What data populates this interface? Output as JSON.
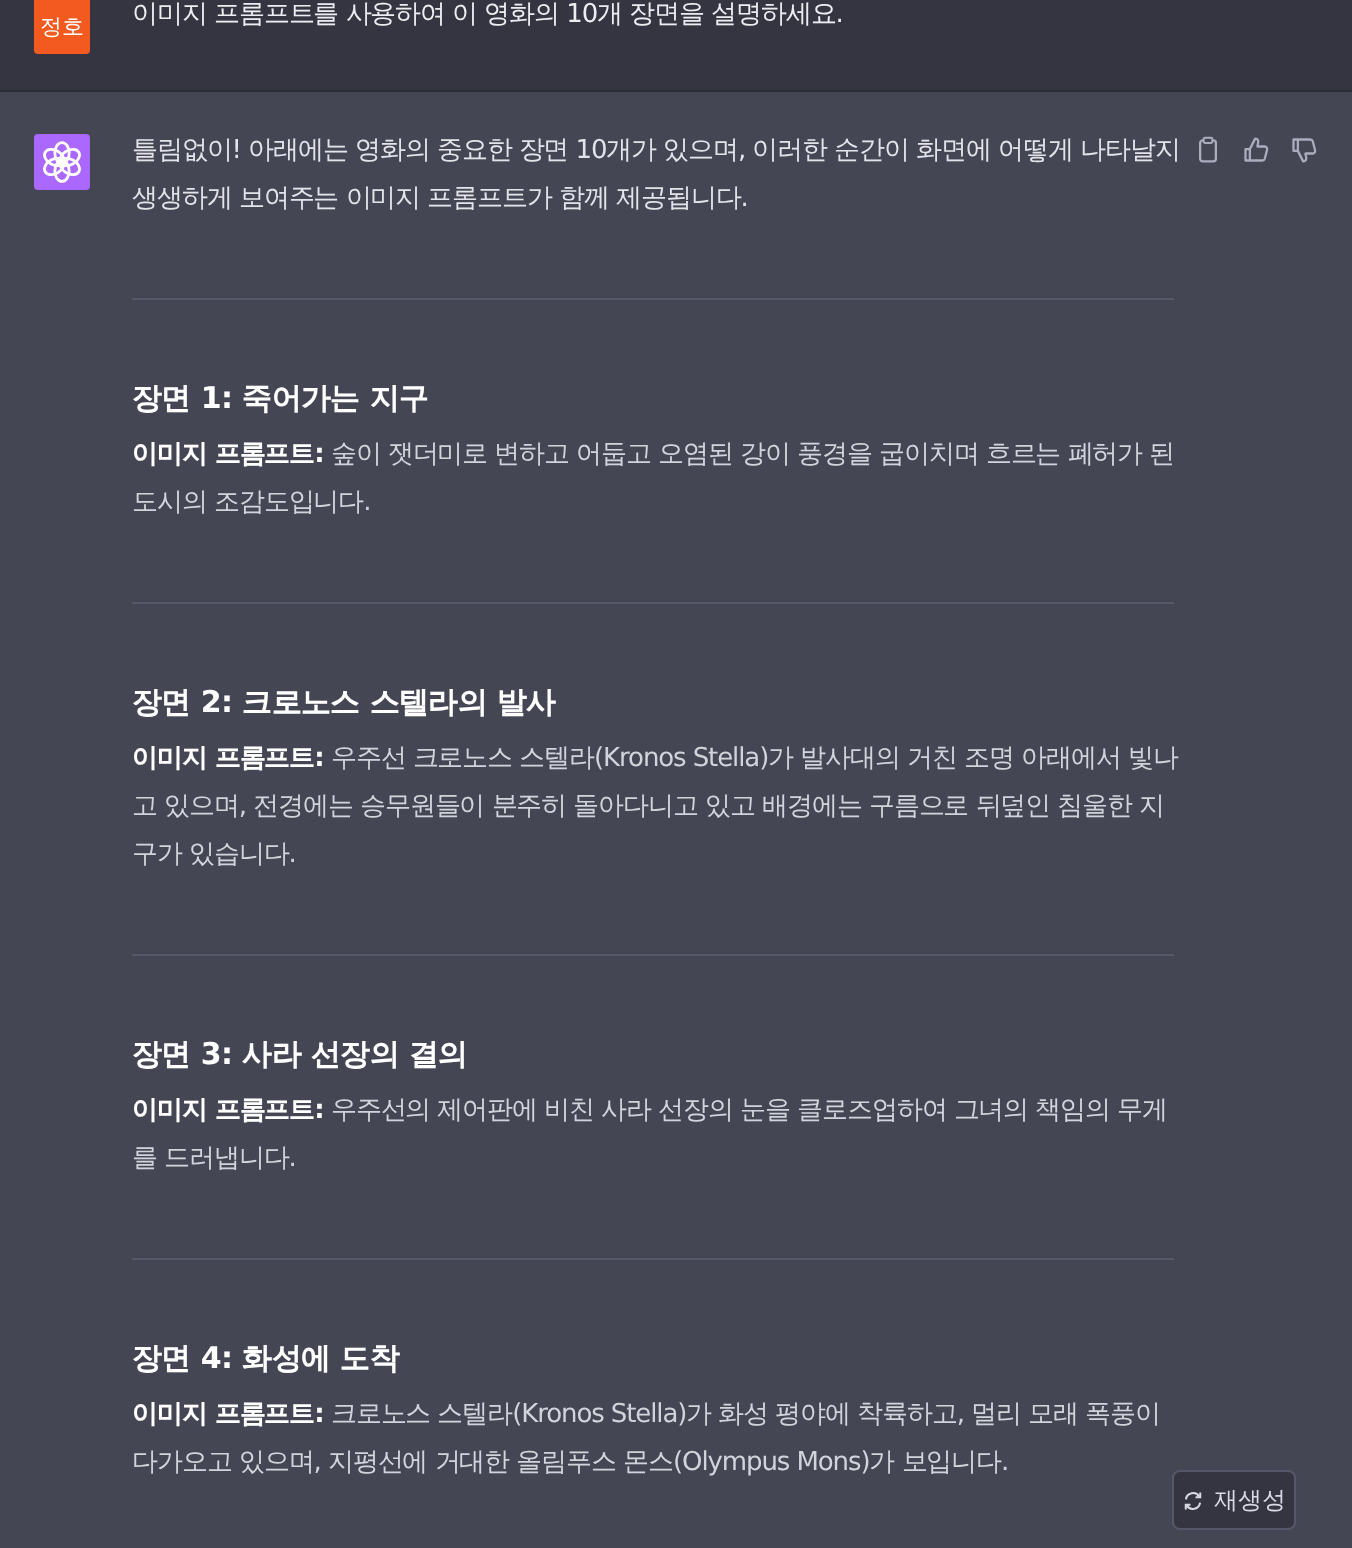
{
  "user_message": {
    "avatar": "정호",
    "text": "이미지 프롬프트를 사용하여 이 영화의 10개 장면을 설명하세요."
  },
  "assistant_message": {
    "intro": "틀림없이! 아래에는 영화의 중요한 장면 10개가 있으며, 이러한 순간이 화면에 어떻게 나타날지 생생하게 보여주는 이미지 프롬프트가 함께 제공됩니다.",
    "scenes": [
      {
        "title": "장면 1: 죽어가는 지구",
        "prompt": "**이미지 프롬프트:** 숲이 잿더미로 변하고 어둡고 오염된 강이 풍경을 굽이치며 흐르는 폐허가 된 도시의 조감도입니다."
      },
      {
        "title": "장면 2: 크로노스 스텔라의 발사",
        "prompt": "**이미지 프롬프트:** 우주선 크로노스 스텔라(Kronos Stella)가 발사대의 거친 조명 아래에서 빛나고 있으며, 전경에는 승무원들이 분주히 돌아다니고 있고 배경에는 구름으로 뒤덮인 침울한 지구가 있습니다."
      },
      {
        "title": "장면 3: 사라 선장의 결의",
        "prompt": "**이미지 프롬프트:** 우주선의 제어판에 비친 사라 선장의 눈을 클로즈업하여 그녀의 책임의 무게를 드러냅니다."
      },
      {
        "title": "장면 4: 화성에 도착",
        "prompt": "**이미지 프롬프트:** 크로노스 스텔라(Kronos Stella)가 화성 평야에 착륙하고, 멀리 모래 폭풍이 다가오고 있으며, 지평선에 거대한 올림푸스 몬스(Olympus Mons)가 보입니다."
      }
    ]
  },
  "regenerate_button": {
    "label": "재생성"
  }
}
